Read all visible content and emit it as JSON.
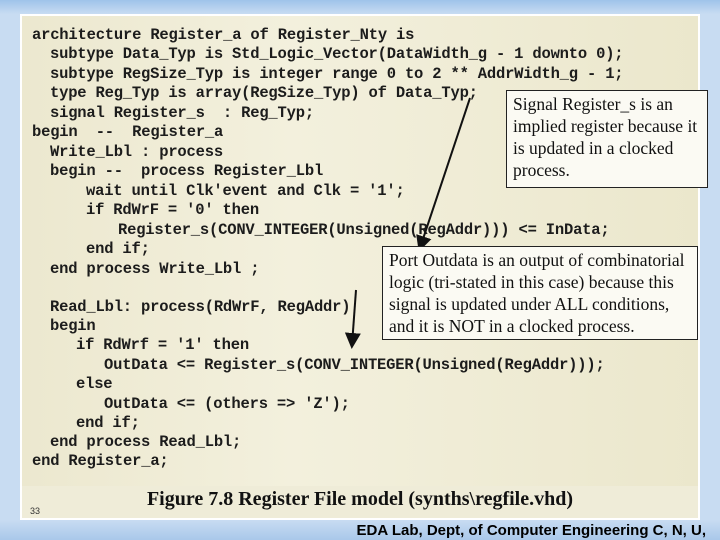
{
  "code_lines": [
    "architecture Register_a of Register_Nty is",
    "subtype Data_Typ is Std_Logic_Vector(DataWidth_g - 1 downto 0);",
    "subtype RegSize_Typ is integer range 0 to 2 ** AddrWidth_g - 1;",
    "type Reg_Typ is array(RegSize_Typ) of Data_Typ;",
    "signal Register_s  : Reg_Typ;",
    "begin  --  Register_a",
    "Write_Lbl : process",
    "begin --  process Register_Lbl",
    "wait until Clk'event and Clk = '1';",
    "if RdWrF = '0' then",
    "Register_s(CONV_INTEGER(Unsigned(RegAddr))) <= InData;",
    "end if;",
    "end process Write_Lbl ;",
    "Read_Lbl: process(RdWrF, RegAddr)",
    "begin",
    "if RdWrf = '1' then",
    "OutData <= Register_s(CONV_INTEGER(Unsigned(RegAddr)));",
    "else",
    "OutData <= (others => 'Z');",
    "end if;",
    "end process Read_Lbl;",
    "end Register_a;"
  ],
  "callouts": [
    "Signal Register_s is an implied register because it is updated in a clocked process.",
    "Port Outdata is an output of combinatorial logic (tri-stated in this case) because this signal is updated under ALL conditions, and it is NOT in a clocked process."
  ],
  "caption": "Figure 7.8 Register File model  (synths\\regfile.vhd)",
  "page_number": "33",
  "footer": "EDA Lab, Dept, of Computer Engineering C, N, U,"
}
